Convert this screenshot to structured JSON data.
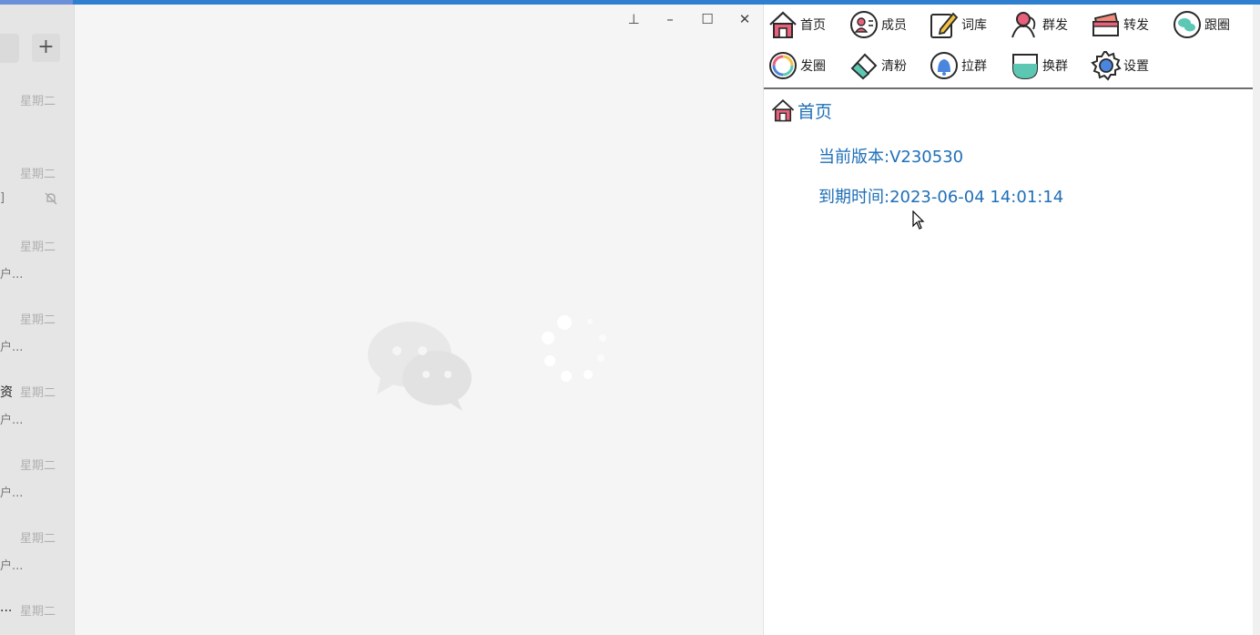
{
  "chat_list": {
    "add_label": "+",
    "items": [
      {
        "day": "星期二",
        "snippet": "",
        "fragment": ""
      },
      {
        "day": "星期二",
        "snippet": "]",
        "fragment": ""
      },
      {
        "day": "星期二",
        "snippet": "户...",
        "fragment": ""
      },
      {
        "day": "星期二",
        "snippet": "户...",
        "fragment": ""
      },
      {
        "day": "星期二",
        "snippet": "户...",
        "fragment": "资"
      },
      {
        "day": "星期二",
        "snippet": "户...",
        "fragment": ""
      },
      {
        "day": "星期二",
        "snippet": "户...",
        "fragment": ""
      },
      {
        "day": "星期二",
        "snippet": "...",
        "fragment": ""
      }
    ]
  },
  "window_controls": {
    "pin": "⊥",
    "minimize": "–",
    "maximize": "☐",
    "close": "✕"
  },
  "toolbar": {
    "items": [
      {
        "label": "首页",
        "icon": "home-icon"
      },
      {
        "label": "成员",
        "icon": "member-icon"
      },
      {
        "label": "词库",
        "icon": "lexicon-icon"
      },
      {
        "label": "群发",
        "icon": "broadcast-icon"
      },
      {
        "label": "转发",
        "icon": "forward-icon"
      },
      {
        "label": "跟圈",
        "icon": "follow-moments-icon"
      },
      {
        "label": "发圈",
        "icon": "post-moments-icon"
      },
      {
        "label": "清粉",
        "icon": "eraser-icon"
      },
      {
        "label": "拉群",
        "icon": "pull-group-icon"
      },
      {
        "label": "换群",
        "icon": "switch-group-icon"
      },
      {
        "label": "设置",
        "icon": "gear-icon"
      }
    ]
  },
  "home": {
    "title": "首页",
    "version_label": "当前版本:",
    "version_value": "V230530",
    "expiry_label": "到期时间:",
    "expiry_value": "2023-06-04 14:01:14"
  },
  "colors": {
    "accent": "#1e6fb8",
    "toolbar_border": "#6e6e6e",
    "title_strip": "#2f7fd0"
  }
}
